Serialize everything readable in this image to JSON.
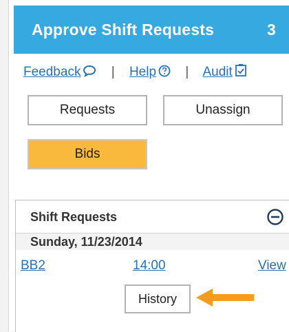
{
  "header": {
    "title": "Approve Shift Requests",
    "count": "3",
    "color": "#35a9e0"
  },
  "links": {
    "feedback": "Feedback",
    "help": "Help",
    "audit": "Audit",
    "separator": "|"
  },
  "buttons": {
    "requests": "Requests",
    "unassign": "Unassign",
    "bids": "Bids",
    "bids_color": "#f8b93c"
  },
  "shift_requests": {
    "title": "Shift Requests",
    "date": "Sunday, 11/23/2014",
    "row": {
      "shift": "BB2",
      "time": "14:00",
      "action": "View"
    },
    "history_label": "History"
  },
  "icons": {
    "feedback": "speech-bubble-icon",
    "help": "question-circle-icon",
    "audit": "checklist-icon",
    "collapse": "minus-circle-icon",
    "pointer": "arrow-left-icon"
  },
  "accent_arrow_color": "#f39c1f"
}
